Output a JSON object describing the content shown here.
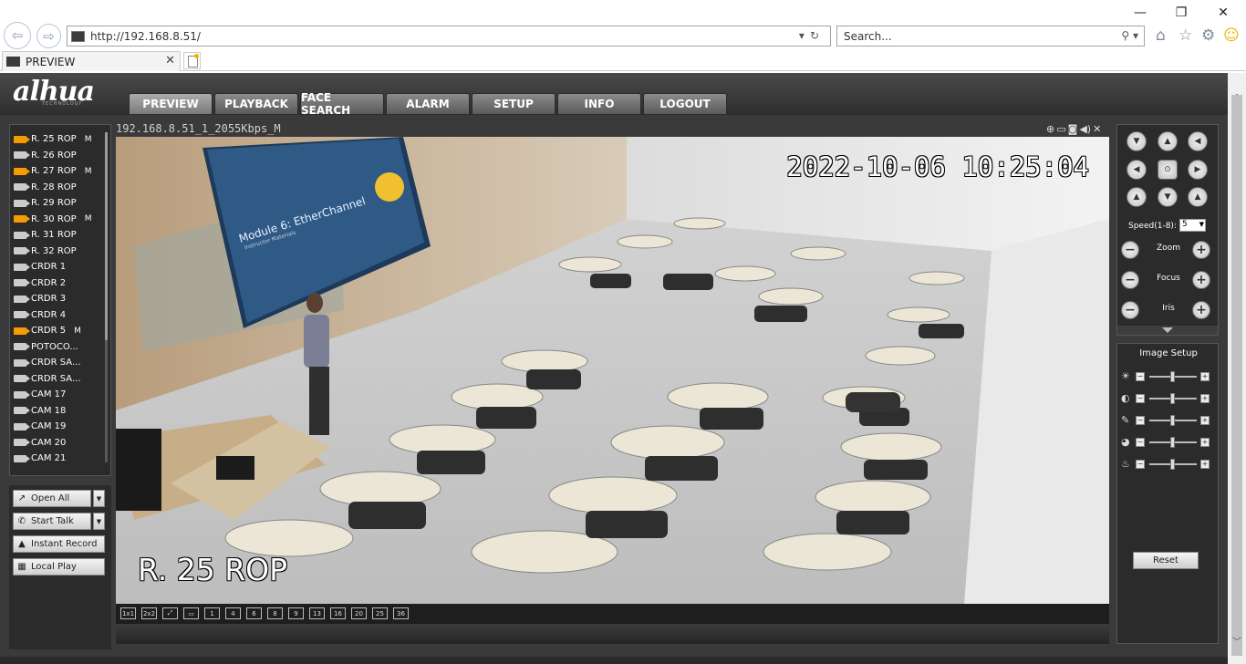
{
  "browser": {
    "url": "http://192.168.8.51/",
    "search_placeholder": "Search...",
    "tab_title": "PREVIEW",
    "minimize": "—",
    "restore": "❐",
    "close": "✕"
  },
  "app": {
    "logo": "alhua",
    "logo_sub": "TECHNOLOGY",
    "nav": [
      "PREVIEW",
      "PLAYBACK",
      "FACE SEARCH",
      "ALARM",
      "SETUP",
      "INFO",
      "LOGOUT"
    ]
  },
  "channels": [
    {
      "name": "R. 25 ROP",
      "active": true,
      "m": "M"
    },
    {
      "name": "R. 26 ROP",
      "active": false,
      "m": ""
    },
    {
      "name": "R. 27 ROP",
      "active": true,
      "m": "M"
    },
    {
      "name": "R. 28 ROP",
      "active": false,
      "m": ""
    },
    {
      "name": "R. 29 ROP",
      "active": false,
      "m": ""
    },
    {
      "name": "R. 30 ROP",
      "active": true,
      "m": "M"
    },
    {
      "name": "R. 31 ROP",
      "active": false,
      "m": ""
    },
    {
      "name": "R. 32 ROP",
      "active": false,
      "m": ""
    },
    {
      "name": "CRDR 1",
      "active": false,
      "m": ""
    },
    {
      "name": "CRDR 2",
      "active": false,
      "m": ""
    },
    {
      "name": "CRDR 3",
      "active": false,
      "m": ""
    },
    {
      "name": "CRDR 4",
      "active": false,
      "m": ""
    },
    {
      "name": "CRDR 5",
      "active": true,
      "m": "M"
    },
    {
      "name": "POTOCO...",
      "active": false,
      "m": ""
    },
    {
      "name": "CRDR SA...",
      "active": false,
      "m": ""
    },
    {
      "name": "CRDR SA...",
      "active": false,
      "m": ""
    },
    {
      "name": "CAM 17",
      "active": false,
      "m": ""
    },
    {
      "name": "CAM 18",
      "active": false,
      "m": ""
    },
    {
      "name": "CAM 19",
      "active": false,
      "m": ""
    },
    {
      "name": "CAM 20",
      "active": false,
      "m": ""
    },
    {
      "name": "CAM 21",
      "active": false,
      "m": ""
    }
  ],
  "left_buttons": {
    "open_all": "Open All",
    "start_talk": "Start Talk",
    "instant_record": "Instant Record",
    "local_play": "Local Play"
  },
  "video": {
    "stream_title": "192.168.8.51_1_2055Kbps_M",
    "osd_time": "2022-10-06 10:25:04",
    "osd_name": "R. 25 ROP",
    "slide_title": "Module 6: EtherChannel",
    "slide_sub": "Instructor Materials"
  },
  "layout_buttons": [
    "1x1",
    "2x2",
    "⤢",
    "▭",
    "1",
    "4",
    "6",
    "8",
    "9",
    "13",
    "16",
    "20",
    "25",
    "36"
  ],
  "ptz": {
    "speed_label": "Speed(1-8):",
    "speed_value": "5",
    "zoom": "Zoom",
    "focus": "Focus",
    "iris": "Iris"
  },
  "image_setup": {
    "title": "Image Setup",
    "reset": "Reset",
    "rows": [
      "brightness-icon",
      "contrast-icon",
      "saturation-icon",
      "hue-icon",
      "gain-icon"
    ]
  },
  "colors": {
    "active_cam": "#f59b00",
    "panel": "#2b2b2b",
    "frame": "#3a3a3a"
  }
}
